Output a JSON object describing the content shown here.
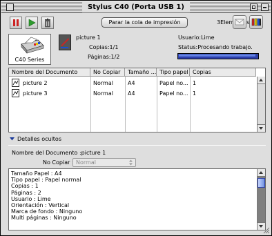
{
  "window": {
    "title": "Stylus C40 (Porta USB 1)"
  },
  "toolbar": {
    "pause_icon": "pause-icon",
    "play_icon": "play-icon",
    "trash_icon": "trash-icon",
    "pause_color": "#cc2222",
    "play_color": "#2e9a2e",
    "stop_queue_label": "Parar la cola de impresión",
    "elements_label": "3Elementos"
  },
  "printer": {
    "name_label": "C40 Series"
  },
  "current_job": {
    "document": "picture 1",
    "user": "Usuario:Lime",
    "copies": "Copias:1/1",
    "pages": "Páginas:1/2",
    "status": "Status:Procesando trabajo.",
    "progress_fraction": 0.97
  },
  "queue": {
    "columns": [
      "Nombre del Documento",
      "No Copiar",
      "Tamaño ...",
      "Tipo papel",
      "Copias"
    ],
    "rows": [
      {
        "name": "picture 2",
        "no_copy": "Normal",
        "size": "A4",
        "paper": "Papel no...",
        "copies": "1"
      },
      {
        "name": "picture 3",
        "no_copy": "Normal",
        "size": "A4",
        "paper": "Papel no...",
        "copies": "1"
      }
    ]
  },
  "details": {
    "toggle_label": "Detalles ocultos",
    "document_name": "Nombre del Documento :picture 1",
    "no_copy_label": "No Copiar :",
    "no_copy_value": "Normal",
    "lines": [
      "Tamaño Papel : A4",
      "Tipo papel : Papel normal",
      "Copias : 1",
      "Páginas : 2",
      "Usuario : Lime",
      "Orientación : Vertical",
      "Marca de fondo : Ninguno",
      "Multi páginas : Ninguno"
    ]
  },
  "accent_color": "#2d40a8"
}
